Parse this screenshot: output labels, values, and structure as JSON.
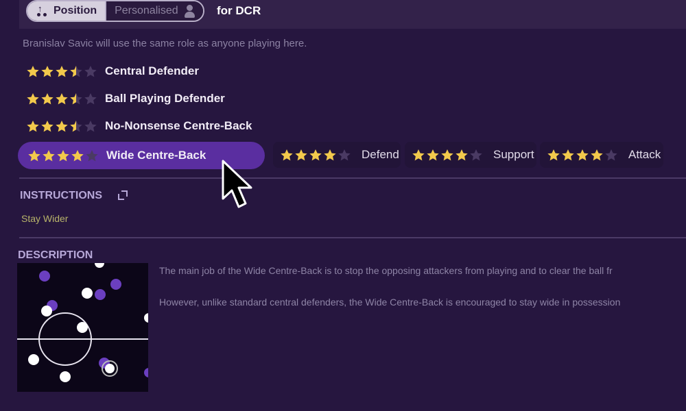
{
  "header": {
    "toggle": {
      "options": [
        {
          "label": "Position",
          "icon": "position-icon",
          "active": true
        },
        {
          "label": "Personalised",
          "icon": "person-icon",
          "active": false
        }
      ]
    },
    "for_label": "for DCR"
  },
  "note": "Branislav Savic will use the same role as anyone playing here.",
  "roles": [
    {
      "name": "Central Defender",
      "rating": 3.5,
      "max": 5,
      "selected": false
    },
    {
      "name": "Ball Playing Defender",
      "rating": 3.5,
      "max": 5,
      "selected": false
    },
    {
      "name": "No-Nonsense Centre-Back",
      "rating": 3.5,
      "max": 5,
      "selected": false
    },
    {
      "name": "Wide Centre-Back",
      "rating": 4,
      "max": 5,
      "selected": true
    }
  ],
  "duties": [
    {
      "label": "Defend",
      "rating": 4,
      "max": 5
    },
    {
      "label": "Support",
      "rating": 4,
      "max": 5
    },
    {
      "label": "Attack",
      "rating": 4,
      "max": 5
    }
  ],
  "instructions": {
    "heading": "INSTRUCTIONS",
    "icon": "popout-icon",
    "items": [
      "Stay Wider"
    ]
  },
  "description": {
    "heading": "DESCRIPTION",
    "paragraphs": [
      "The main job of the Wide Centre-Back is to stop the opposing attackers from playing and to clear the ball fr",
      "However, unlike standard central defenders, the Wide Centre-Back is encouraged to stay wide in possession"
    ]
  },
  "colors": {
    "star_filled": "#f2c94c",
    "star_empty": "#4a3a63",
    "selected_role_bg": "#5a2ea0",
    "instruction_text": "#b8b46a"
  }
}
